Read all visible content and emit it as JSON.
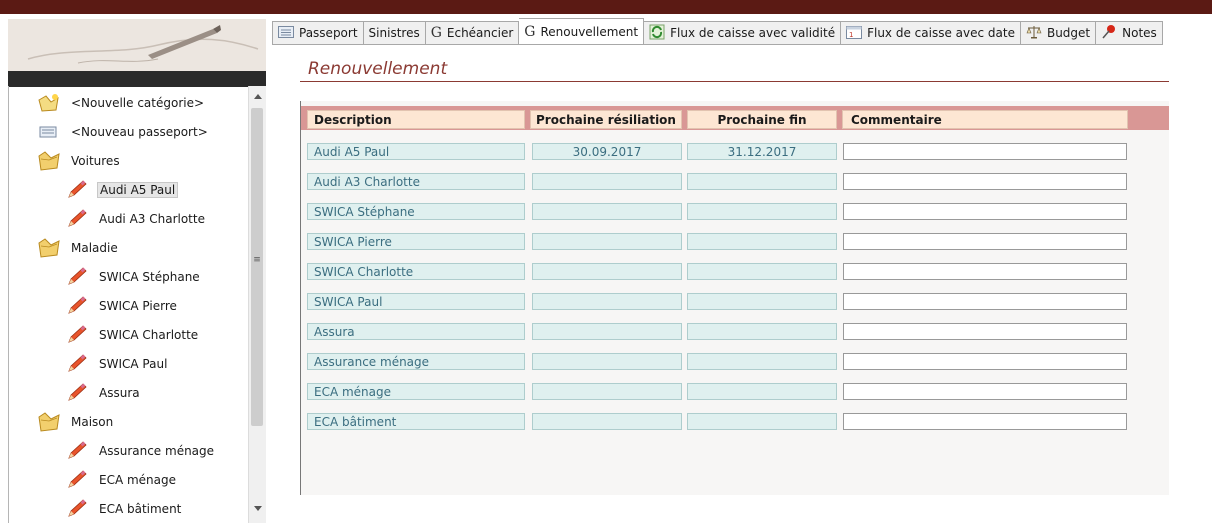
{
  "sidebar": {
    "items": [
      {
        "label": "<Nouvelle catégorie>",
        "icon": "new-category-icon"
      },
      {
        "label": "<Nouveau passeport>",
        "icon": "new-passport-icon"
      },
      {
        "label": "Voitures",
        "icon": "folder-icon"
      },
      {
        "label": "Audi A5 Paul",
        "icon": "pencil-icon"
      },
      {
        "label": "Audi A3 Charlotte",
        "icon": "pencil-icon"
      },
      {
        "label": "Maladie",
        "icon": "folder-icon"
      },
      {
        "label": "SWICA Stéphane",
        "icon": "pencil-icon"
      },
      {
        "label": "SWICA Pierre",
        "icon": "pencil-icon"
      },
      {
        "label": "SWICA Charlotte",
        "icon": "pencil-icon"
      },
      {
        "label": "SWICA Paul",
        "icon": "pencil-icon"
      },
      {
        "label": "Assura",
        "icon": "pencil-icon"
      },
      {
        "label": "Maison",
        "icon": "folder-icon"
      },
      {
        "label": "Assurance ménage",
        "icon": "pencil-icon"
      },
      {
        "label": "ECA ménage",
        "icon": "pencil-icon"
      },
      {
        "label": "ECA bâtiment",
        "icon": "pencil-icon"
      }
    ]
  },
  "tabs": [
    {
      "label": "Passeport",
      "icon": "passport-icon"
    },
    {
      "label": "Sinistres",
      "icon": ""
    },
    {
      "label": "Echéancier",
      "icon": "g-icon"
    },
    {
      "label": "Renouvellement",
      "icon": "g-icon",
      "active": true
    },
    {
      "label": "Flux de caisse avec validité",
      "icon": "cashflow-refresh-icon"
    },
    {
      "label": "Flux de caisse avec date",
      "icon": "calendar-icon"
    },
    {
      "label": "Budget",
      "icon": "scales-icon"
    },
    {
      "label": "Notes",
      "icon": "pin-icon"
    }
  ],
  "page": {
    "title": "Renouvellement"
  },
  "table": {
    "headers": [
      "Description",
      "Prochaine résiliation",
      "Prochaine fin",
      "Commentaire"
    ],
    "rows": [
      {
        "description": "Audi A5 Paul",
        "resiliation": "30.09.2017",
        "fin": "31.12.2017",
        "commentaire": ""
      },
      {
        "description": "Audi A3 Charlotte",
        "resiliation": "",
        "fin": "",
        "commentaire": ""
      },
      {
        "description": "SWICA Stéphane",
        "resiliation": "",
        "fin": "",
        "commentaire": ""
      },
      {
        "description": "SWICA Pierre",
        "resiliation": "",
        "fin": "",
        "commentaire": ""
      },
      {
        "description": "SWICA Charlotte",
        "resiliation": "",
        "fin": "",
        "commentaire": ""
      },
      {
        "description": "SWICA Paul",
        "resiliation": "",
        "fin": "",
        "commentaire": ""
      },
      {
        "description": "Assura",
        "resiliation": "",
        "fin": "",
        "commentaire": ""
      },
      {
        "description": "Assurance ménage",
        "resiliation": "",
        "fin": "",
        "commentaire": ""
      },
      {
        "description": "ECA ménage",
        "resiliation": "",
        "fin": "",
        "commentaire": ""
      },
      {
        "description": "ECA bâtiment",
        "resiliation": "",
        "fin": "",
        "commentaire": ""
      }
    ]
  },
  "colors": {
    "brand": "#5b1a14",
    "title": "#8b3a33",
    "header_bar": "#d99795",
    "header_cell": "#fde6d3",
    "cell": "#dff0ef",
    "cell_text": "#3b6e80"
  }
}
